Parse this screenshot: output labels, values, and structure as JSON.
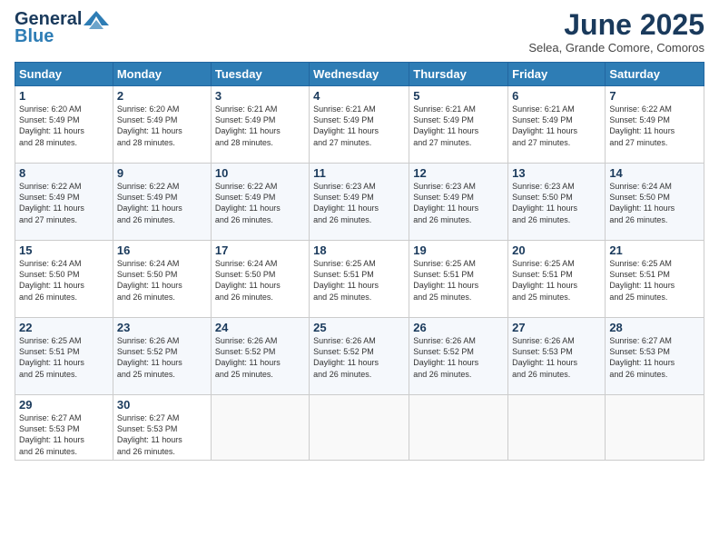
{
  "logo": {
    "line1": "General",
    "line2": "Blue",
    "tagline": ""
  },
  "title": "June 2025",
  "subtitle": "Selea, Grande Comore, Comoros",
  "headers": [
    "Sunday",
    "Monday",
    "Tuesday",
    "Wednesday",
    "Thursday",
    "Friday",
    "Saturday"
  ],
  "weeks": [
    [
      {
        "day": "1",
        "lines": [
          "Sunrise: 6:20 AM",
          "Sunset: 5:49 PM",
          "Daylight: 11 hours",
          "and 28 minutes."
        ]
      },
      {
        "day": "2",
        "lines": [
          "Sunrise: 6:20 AM",
          "Sunset: 5:49 PM",
          "Daylight: 11 hours",
          "and 28 minutes."
        ]
      },
      {
        "day": "3",
        "lines": [
          "Sunrise: 6:21 AM",
          "Sunset: 5:49 PM",
          "Daylight: 11 hours",
          "and 28 minutes."
        ]
      },
      {
        "day": "4",
        "lines": [
          "Sunrise: 6:21 AM",
          "Sunset: 5:49 PM",
          "Daylight: 11 hours",
          "and 27 minutes."
        ]
      },
      {
        "day": "5",
        "lines": [
          "Sunrise: 6:21 AM",
          "Sunset: 5:49 PM",
          "Daylight: 11 hours",
          "and 27 minutes."
        ]
      },
      {
        "day": "6",
        "lines": [
          "Sunrise: 6:21 AM",
          "Sunset: 5:49 PM",
          "Daylight: 11 hours",
          "and 27 minutes."
        ]
      },
      {
        "day": "7",
        "lines": [
          "Sunrise: 6:22 AM",
          "Sunset: 5:49 PM",
          "Daylight: 11 hours",
          "and 27 minutes."
        ]
      }
    ],
    [
      {
        "day": "8",
        "lines": [
          "Sunrise: 6:22 AM",
          "Sunset: 5:49 PM",
          "Daylight: 11 hours",
          "and 27 minutes."
        ]
      },
      {
        "day": "9",
        "lines": [
          "Sunrise: 6:22 AM",
          "Sunset: 5:49 PM",
          "Daylight: 11 hours",
          "and 26 minutes."
        ]
      },
      {
        "day": "10",
        "lines": [
          "Sunrise: 6:22 AM",
          "Sunset: 5:49 PM",
          "Daylight: 11 hours",
          "and 26 minutes."
        ]
      },
      {
        "day": "11",
        "lines": [
          "Sunrise: 6:23 AM",
          "Sunset: 5:49 PM",
          "Daylight: 11 hours",
          "and 26 minutes."
        ]
      },
      {
        "day": "12",
        "lines": [
          "Sunrise: 6:23 AM",
          "Sunset: 5:49 PM",
          "Daylight: 11 hours",
          "and 26 minutes."
        ]
      },
      {
        "day": "13",
        "lines": [
          "Sunrise: 6:23 AM",
          "Sunset: 5:50 PM",
          "Daylight: 11 hours",
          "and 26 minutes."
        ]
      },
      {
        "day": "14",
        "lines": [
          "Sunrise: 6:24 AM",
          "Sunset: 5:50 PM",
          "Daylight: 11 hours",
          "and 26 minutes."
        ]
      }
    ],
    [
      {
        "day": "15",
        "lines": [
          "Sunrise: 6:24 AM",
          "Sunset: 5:50 PM",
          "Daylight: 11 hours",
          "and 26 minutes."
        ]
      },
      {
        "day": "16",
        "lines": [
          "Sunrise: 6:24 AM",
          "Sunset: 5:50 PM",
          "Daylight: 11 hours",
          "and 26 minutes."
        ]
      },
      {
        "day": "17",
        "lines": [
          "Sunrise: 6:24 AM",
          "Sunset: 5:50 PM",
          "Daylight: 11 hours",
          "and 26 minutes."
        ]
      },
      {
        "day": "18",
        "lines": [
          "Sunrise: 6:25 AM",
          "Sunset: 5:51 PM",
          "Daylight: 11 hours",
          "and 25 minutes."
        ]
      },
      {
        "day": "19",
        "lines": [
          "Sunrise: 6:25 AM",
          "Sunset: 5:51 PM",
          "Daylight: 11 hours",
          "and 25 minutes."
        ]
      },
      {
        "day": "20",
        "lines": [
          "Sunrise: 6:25 AM",
          "Sunset: 5:51 PM",
          "Daylight: 11 hours",
          "and 25 minutes."
        ]
      },
      {
        "day": "21",
        "lines": [
          "Sunrise: 6:25 AM",
          "Sunset: 5:51 PM",
          "Daylight: 11 hours",
          "and 25 minutes."
        ]
      }
    ],
    [
      {
        "day": "22",
        "lines": [
          "Sunrise: 6:25 AM",
          "Sunset: 5:51 PM",
          "Daylight: 11 hours",
          "and 25 minutes."
        ]
      },
      {
        "day": "23",
        "lines": [
          "Sunrise: 6:26 AM",
          "Sunset: 5:52 PM",
          "Daylight: 11 hours",
          "and 25 minutes."
        ]
      },
      {
        "day": "24",
        "lines": [
          "Sunrise: 6:26 AM",
          "Sunset: 5:52 PM",
          "Daylight: 11 hours",
          "and 25 minutes."
        ]
      },
      {
        "day": "25",
        "lines": [
          "Sunrise: 6:26 AM",
          "Sunset: 5:52 PM",
          "Daylight: 11 hours",
          "and 26 minutes."
        ]
      },
      {
        "day": "26",
        "lines": [
          "Sunrise: 6:26 AM",
          "Sunset: 5:52 PM",
          "Daylight: 11 hours",
          "and 26 minutes."
        ]
      },
      {
        "day": "27",
        "lines": [
          "Sunrise: 6:26 AM",
          "Sunset: 5:53 PM",
          "Daylight: 11 hours",
          "and 26 minutes."
        ]
      },
      {
        "day": "28",
        "lines": [
          "Sunrise: 6:27 AM",
          "Sunset: 5:53 PM",
          "Daylight: 11 hours",
          "and 26 minutes."
        ]
      }
    ],
    [
      {
        "day": "29",
        "lines": [
          "Sunrise: 6:27 AM",
          "Sunset: 5:53 PM",
          "Daylight: 11 hours",
          "and 26 minutes."
        ]
      },
      {
        "day": "30",
        "lines": [
          "Sunrise: 6:27 AM",
          "Sunset: 5:53 PM",
          "Daylight: 11 hours",
          "and 26 minutes."
        ]
      },
      {
        "day": "",
        "lines": []
      },
      {
        "day": "",
        "lines": []
      },
      {
        "day": "",
        "lines": []
      },
      {
        "day": "",
        "lines": []
      },
      {
        "day": "",
        "lines": []
      }
    ]
  ]
}
